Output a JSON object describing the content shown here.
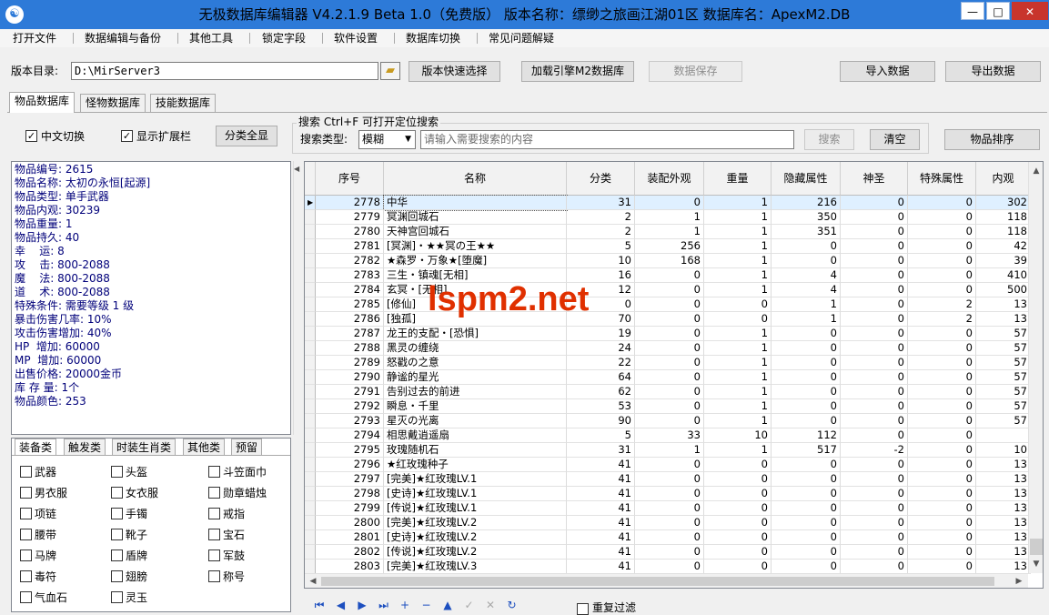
{
  "window": {
    "title": "无极数据库编辑器 V4.2.1.9   Beta 1.0（免费版）   版本名称：缥缈之旅画江湖01区    数据库名：ApexM2.DB",
    "min": "—",
    "max": "□",
    "close": "✕",
    "app_icon": "☯"
  },
  "menu": [
    "打开文件",
    "数据编辑与备份",
    "其他工具",
    "锁定字段",
    "软件设置",
    "数据库切换",
    "常见问题解疑"
  ],
  "toolbar": {
    "dir_label": "版本目录:",
    "dir_value": "D:\\MirServer3",
    "quick_select": "版本快速选择",
    "load_engine": "加载引擎M2数据库",
    "save_data": "数据保存",
    "import_data": "导入数据",
    "export_data": "导出数据"
  },
  "tabs": [
    "物品数据库",
    "怪物数据库",
    "技能数据库"
  ],
  "options": {
    "cn_switch": "中文切换",
    "show_ext": "显示扩展栏",
    "show_all_cat": "分类全显"
  },
  "search": {
    "group_title": "搜索  Ctrl+F 可打开定位搜索",
    "type_label": "搜索类型:",
    "type_value": "模糊",
    "placeholder": "请输入需要搜索的内容",
    "search_btn": "搜索",
    "clear_btn": "清空",
    "sort_btn": "物品排序"
  },
  "info": [
    "物品编号: 2615",
    "物品名称: 太初の永恒[起源]",
    "物品类型: 单手武器",
    "物品内观: 30239",
    "物品重量: 1",
    "物品持久: 40",
    "幸    运: 8",
    "攻    击: 800-2088",
    "魔    法: 800-2088",
    "道    术: 800-2088",
    "特殊条件: 需要等级 1 级",
    "暴击伤害几率: 10%",
    "攻击伤害增加: 40%",
    "HP  增加: 60000",
    "MP  增加: 60000",
    "出售价格: 20000金币",
    "库 存 量: 1个",
    "物品颜色: 253"
  ],
  "cat_tabs": [
    "装备类",
    "触发类",
    "时装生肖类",
    "其他类",
    "预留"
  ],
  "cat_items": [
    [
      "武器",
      "头盔",
      "斗笠面巾"
    ],
    [
      "男衣服",
      "女衣服",
      "勋章蜡烛"
    ],
    [
      "项链",
      "手镯",
      "戒指"
    ],
    [
      "腰带",
      "靴子",
      "宝石"
    ],
    [
      "马牌",
      "盾牌",
      "军鼓"
    ],
    [
      "毒符",
      "翅膀",
      "称号"
    ],
    [
      "气血石",
      "灵玉",
      ""
    ]
  ],
  "grid": {
    "headers": [
      "序号",
      "名称",
      "分类",
      "装配外观",
      "重量",
      "隐藏属性",
      "神圣",
      "特殊属性",
      "内观"
    ],
    "rows": [
      [
        "2778",
        "中华",
        "31",
        "0",
        "1",
        "216",
        "0",
        "0",
        "302"
      ],
      [
        "2779",
        "冥渊回城石",
        "2",
        "1",
        "1",
        "350",
        "0",
        "0",
        "118"
      ],
      [
        "2780",
        "天神宫回城石",
        "2",
        "1",
        "1",
        "351",
        "0",
        "0",
        "118"
      ],
      [
        "2781",
        "[冥渊]・★★冥の王★★",
        "5",
        "256",
        "1",
        "0",
        "0",
        "0",
        "42"
      ],
      [
        "2782",
        "★森罗・万象★[堕魔]",
        "10",
        "168",
        "1",
        "0",
        "0",
        "0",
        "39"
      ],
      [
        "2783",
        "三生・镇魂[无相]",
        "16",
        "0",
        "1",
        "4",
        "0",
        "0",
        "410"
      ],
      [
        "2784",
        "玄冥・[无相]",
        "12",
        "0",
        "1",
        "4",
        "0",
        "0",
        "500"
      ],
      [
        "2785",
        "[修仙]",
        "0",
        "0",
        "0",
        "1",
        "0",
        "2",
        "13"
      ],
      [
        "2786",
        "[独孤]",
        "70",
        "0",
        "0",
        "1",
        "0",
        "2",
        "13"
      ],
      [
        "2787",
        "龙王的支配・[恐惧]",
        "19",
        "0",
        "1",
        "0",
        "0",
        "0",
        "57"
      ],
      [
        "2788",
        "黑灵の缠绕",
        "24",
        "0",
        "1",
        "0",
        "0",
        "0",
        "57"
      ],
      [
        "2789",
        "怒戳の之意",
        "22",
        "0",
        "1",
        "0",
        "0",
        "0",
        "57"
      ],
      [
        "2790",
        "静谧的星光",
        "64",
        "0",
        "1",
        "0",
        "0",
        "0",
        "57"
      ],
      [
        "2791",
        "告别过去的前进",
        "62",
        "0",
        "1",
        "0",
        "0",
        "0",
        "57"
      ],
      [
        "2792",
        "瞬息・千里",
        "53",
        "0",
        "1",
        "0",
        "0",
        "0",
        "57"
      ],
      [
        "2793",
        "星灭の光离",
        "90",
        "0",
        "1",
        "0",
        "0",
        "0",
        "57"
      ],
      [
        "2794",
        "相思戴逍遥扇",
        "5",
        "33",
        "10",
        "112",
        "0",
        "0",
        ""
      ],
      [
        "2795",
        "玫瑰随机石",
        "31",
        "1",
        "1",
        "517",
        "-2",
        "0",
        "10"
      ],
      [
        "2796",
        "★红玫瑰种子",
        "41",
        "0",
        "0",
        "0",
        "0",
        "0",
        "13"
      ],
      [
        "2797",
        "[完美]★红玫瑰LV.1",
        "41",
        "0",
        "0",
        "0",
        "0",
        "0",
        "13"
      ],
      [
        "2798",
        "[史诗]★红玫瑰LV.1",
        "41",
        "0",
        "0",
        "0",
        "0",
        "0",
        "13"
      ],
      [
        "2799",
        "[传说]★红玫瑰LV.1",
        "41",
        "0",
        "0",
        "0",
        "0",
        "0",
        "13"
      ],
      [
        "2800",
        "[完美]★红玫瑰LV.2",
        "41",
        "0",
        "0",
        "0",
        "0",
        "0",
        "13"
      ],
      [
        "2801",
        "[史诗]★红玫瑰LV.2",
        "41",
        "0",
        "0",
        "0",
        "0",
        "0",
        "13"
      ],
      [
        "2802",
        "[传说]★红玫瑰LV.2",
        "41",
        "0",
        "0",
        "0",
        "0",
        "0",
        "13"
      ],
      [
        "2803",
        "[完美]★红玫瑰LV.3",
        "41",
        "0",
        "0",
        "0",
        "0",
        "0",
        "13"
      ]
    ]
  },
  "navigator": [
    "first-icon",
    "prior-icon",
    "next-icon",
    "last-icon",
    "insert-icon",
    "delete-icon",
    "edit-icon",
    "post-icon",
    "cancel-icon",
    "refresh-icon"
  ],
  "filter_label": "重复过滤",
  "watermark": "lspm2.net"
}
